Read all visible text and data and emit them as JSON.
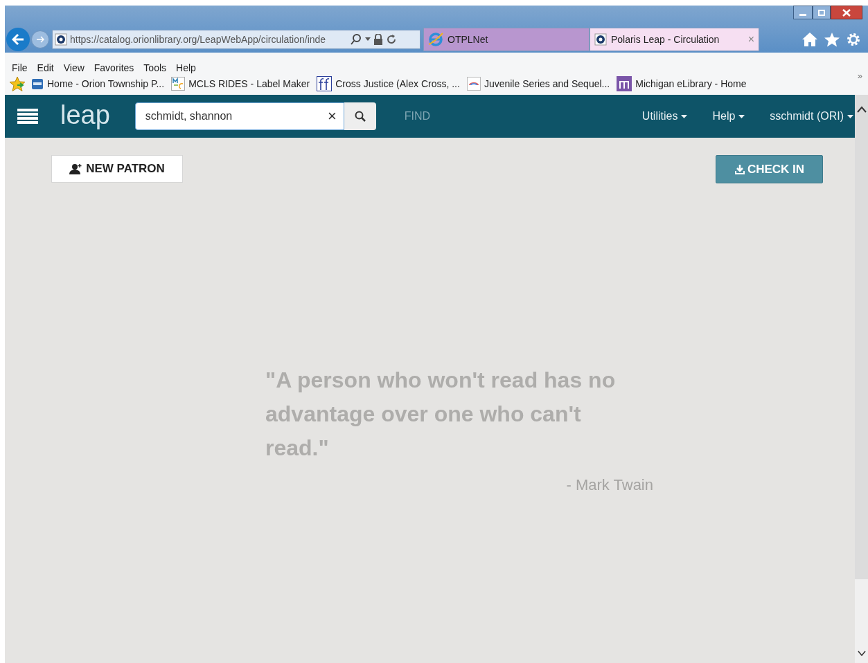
{
  "browser": {
    "url": "https://catalog.orionlibrary.org/LeapWebApp/circulation/inde",
    "tabs": [
      {
        "title": "OTPLNet",
        "selected": false,
        "closable": false
      },
      {
        "title": "Polaris Leap - Circulation",
        "selected": true,
        "closable": true
      }
    ],
    "close_glyph": "×",
    "menu": [
      "File",
      "Edit",
      "View",
      "Favorites",
      "Tools",
      "Help"
    ],
    "favorites": [
      {
        "title": "Home - Orion Township P...",
        "kind": "library"
      },
      {
        "title": "MCLS RIDES - Label Maker",
        "kind": "mcls"
      },
      {
        "title": "Cross Justice (Alex Cross, ...",
        "kind": "ff"
      },
      {
        "title": "Juvenile Series and Sequel...",
        "kind": "rainbow"
      },
      {
        "title": "Michigan eLibrary - Home",
        "kind": "melcat"
      }
    ],
    "overflow": "»"
  },
  "app": {
    "logo": "leap",
    "search": {
      "value": "schmidt, shannon",
      "clear": "×"
    },
    "find": "FIND",
    "menus": [
      "Utilities",
      "Help",
      "sschmidt (ORI)"
    ],
    "new_patron": "NEW PATRON",
    "check_in": "CHECK IN",
    "quote": "\"A person who won't read has no advantage over one who can't read.\"",
    "author": "- Mark Twain"
  }
}
